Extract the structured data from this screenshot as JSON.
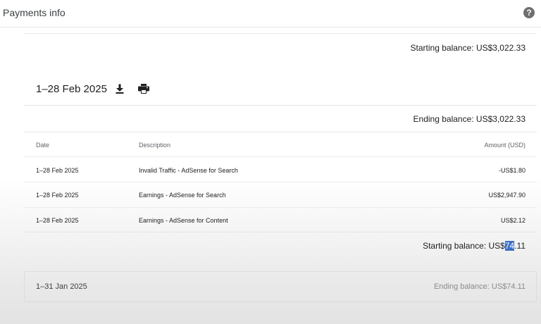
{
  "header": {
    "title": "Payments info",
    "help_icon": "help-circle-icon"
  },
  "february": {
    "starting_balance_top": "Starting balance: US$3,022.33",
    "period": "1–28 Feb 2025",
    "download_icon": "download-icon",
    "print_icon": "print-icon",
    "ending_balance": "Ending balance: US$3,022.33",
    "columns": {
      "date": "Date",
      "description": "Description",
      "amount": "Amount (USD)"
    },
    "rows": [
      {
        "date": "1–28 Feb 2025",
        "description": "Invalid Traffic - AdSense for Search",
        "amount": "-US$1.80"
      },
      {
        "date": "1–28 Feb 2025",
        "description": "Earnings - AdSense for Search",
        "amount": "US$2,947.90"
      },
      {
        "date": "1–28 Feb 2025",
        "description": "Earnings - AdSense for Content",
        "amount": "US$2.12"
      }
    ],
    "starting_balance_bottom": {
      "prefix": "Starting balance: US$",
      "highlighted": "74",
      "suffix": ".11"
    }
  },
  "january": {
    "period": "1–31 Jan 2025",
    "ending_balance": "Ending balance: US$74.11"
  },
  "colors": {
    "selection": "#3e6fc4"
  }
}
